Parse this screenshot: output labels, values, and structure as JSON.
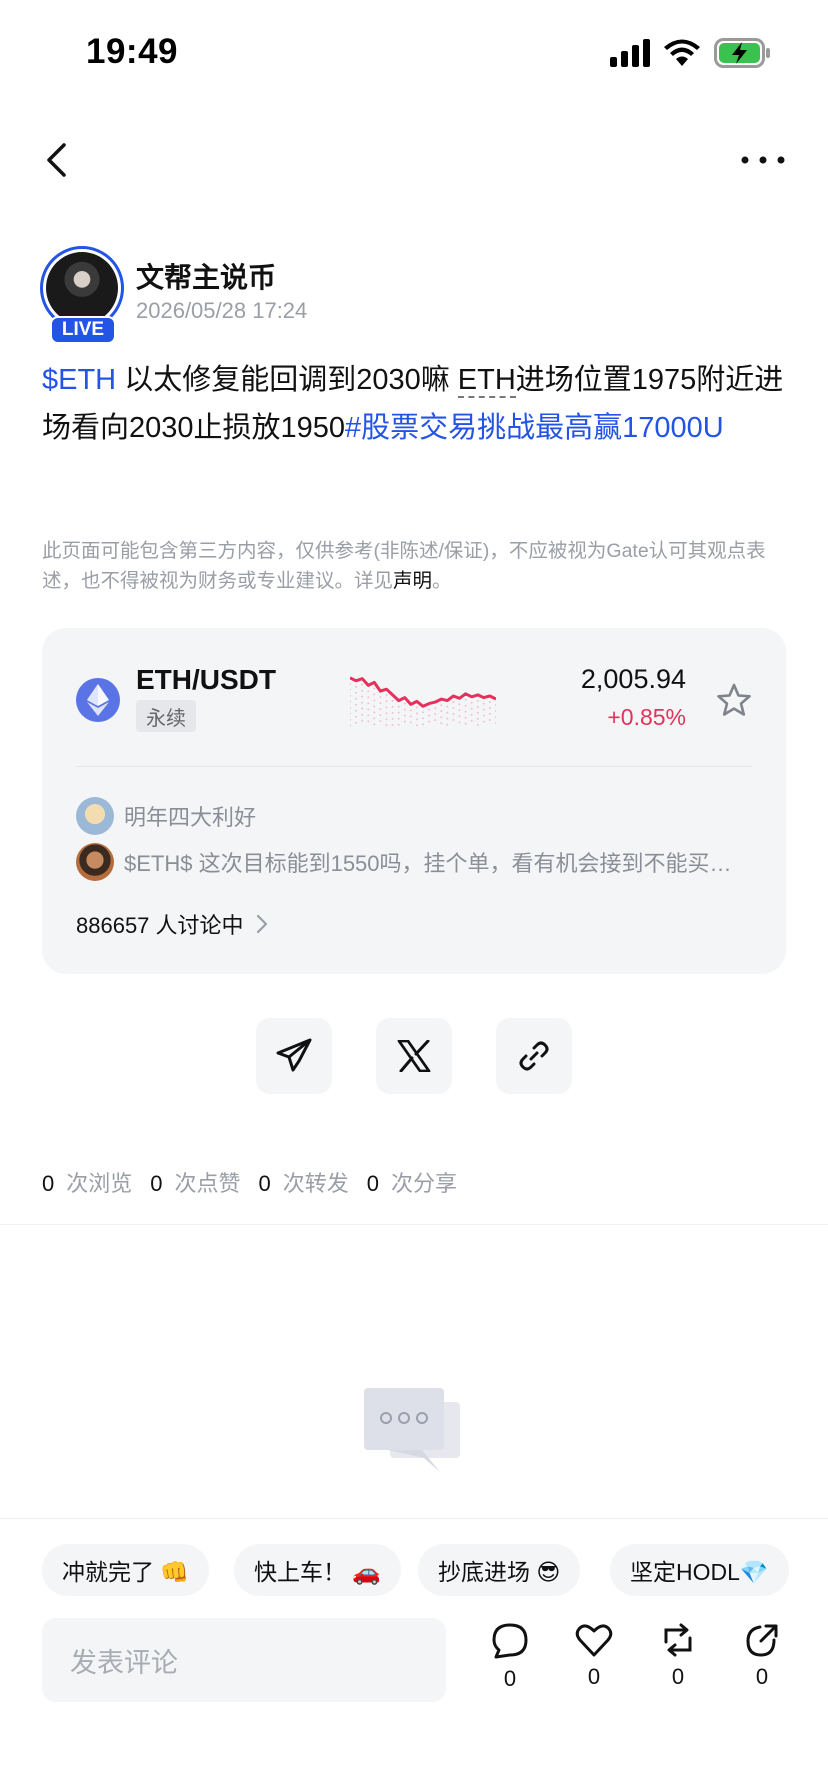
{
  "status_bar": {
    "time": "19:49"
  },
  "author": {
    "name": "文帮主说币",
    "time": "2026/05/28 17:24",
    "badge": "LIVE"
  },
  "post": {
    "link1": "$ETH",
    "text1": " 以太修复能回调到2030嘛 ",
    "ticker": "ETH",
    "text2": "进场位置1975附近进场看向2030止损放1950",
    "hashtag": "#股票交易挑战最高赢17000U"
  },
  "disclaimer": {
    "text": "此页面可能包含第三方内容，仅供参考(非陈述/保证)，不应被视为Gate认可其观点表述，也不得被视为财务或专业建议。详见",
    "link": "声明",
    "end": "。"
  },
  "market_card": {
    "pair": "ETH/USDT",
    "tag": "永续",
    "price": "2,005.94",
    "change": "+0.85%",
    "accent_color": "#e5315c",
    "sparkline": [
      0.1,
      0.18,
      0.12,
      0.3,
      0.22,
      0.45,
      0.4,
      0.55,
      0.7,
      0.62,
      0.8,
      0.72,
      0.85,
      0.78,
      0.74,
      0.66,
      0.7,
      0.58,
      0.64,
      0.52,
      0.6,
      0.55,
      0.62,
      0.58,
      0.66
    ],
    "comments": [
      {
        "user": "明年四大利好",
        "text": ""
      },
      {
        "user": "",
        "text": "$ETH$  这次目标能到1550吗，挂个单，看有机会接到不能买入，接…"
      }
    ],
    "discussing": "886657 人讨论中"
  },
  "stats": [
    {
      "count": "0",
      "label": "次浏览"
    },
    {
      "count": "0",
      "label": "次点赞"
    },
    {
      "count": "0",
      "label": "次转发"
    },
    {
      "count": "0",
      "label": "次分享"
    }
  ],
  "quick_replies": [
    "冲就完了 👊",
    "快上车！ 🚗",
    "抄底进场 😎",
    "坚定HODL💎"
  ],
  "comment_box": {
    "placeholder": "发表评论"
  },
  "actions": [
    {
      "icon": "comment-icon",
      "count": "0"
    },
    {
      "icon": "heart-icon",
      "count": "0"
    },
    {
      "icon": "repost-icon",
      "count": "0"
    },
    {
      "icon": "share-icon",
      "count": "0"
    }
  ]
}
